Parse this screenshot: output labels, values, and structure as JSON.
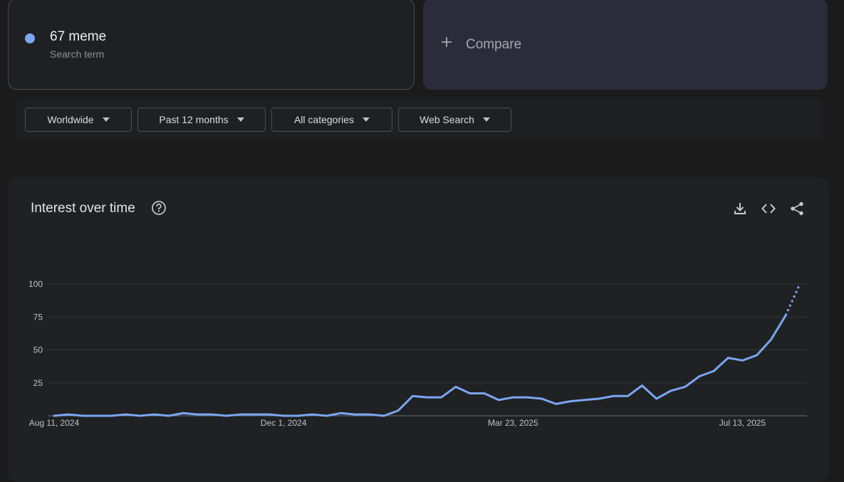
{
  "search_term": {
    "name": "67 meme",
    "sub": "Search term",
    "color": "#7ba6f0"
  },
  "compare": {
    "label": "Compare",
    "icon": "plus-icon"
  },
  "filters": {
    "region": "Worldwide",
    "period": "Past 12 months",
    "category": "All categories",
    "search_type": "Web Search"
  },
  "panel": {
    "title": "Interest over time",
    "icons": [
      "help-icon",
      "download-icon",
      "embed-code-icon",
      "share-icon"
    ]
  },
  "chart_data": {
    "type": "line",
    "title": "",
    "xlabel": "",
    "ylabel": "",
    "ylim": [
      0,
      100
    ],
    "y_ticks": [
      25,
      50,
      75,
      100
    ],
    "x_tick_labels": [
      "Aug 11, 2024",
      "Dec 1, 2024",
      "Mar 23, 2025",
      "Jul 13, 2025"
    ],
    "x_tick_indices": [
      0,
      16,
      32,
      48
    ],
    "grid": true,
    "line_color": "#7ba6f0",
    "partial_data_last_point": true,
    "series": [
      {
        "values": [
          0,
          1,
          0,
          0,
          0,
          1,
          0,
          1,
          0,
          2,
          1,
          1,
          0,
          1,
          1,
          1,
          0,
          0,
          1,
          0,
          2,
          1,
          1,
          0,
          4,
          15,
          14,
          14,
          22,
          17,
          17,
          12,
          14,
          14,
          13,
          9,
          11,
          12,
          13,
          15,
          15,
          23,
          13,
          19,
          22,
          30,
          34,
          44,
          42,
          46,
          58,
          76,
          100
        ]
      }
    ]
  }
}
